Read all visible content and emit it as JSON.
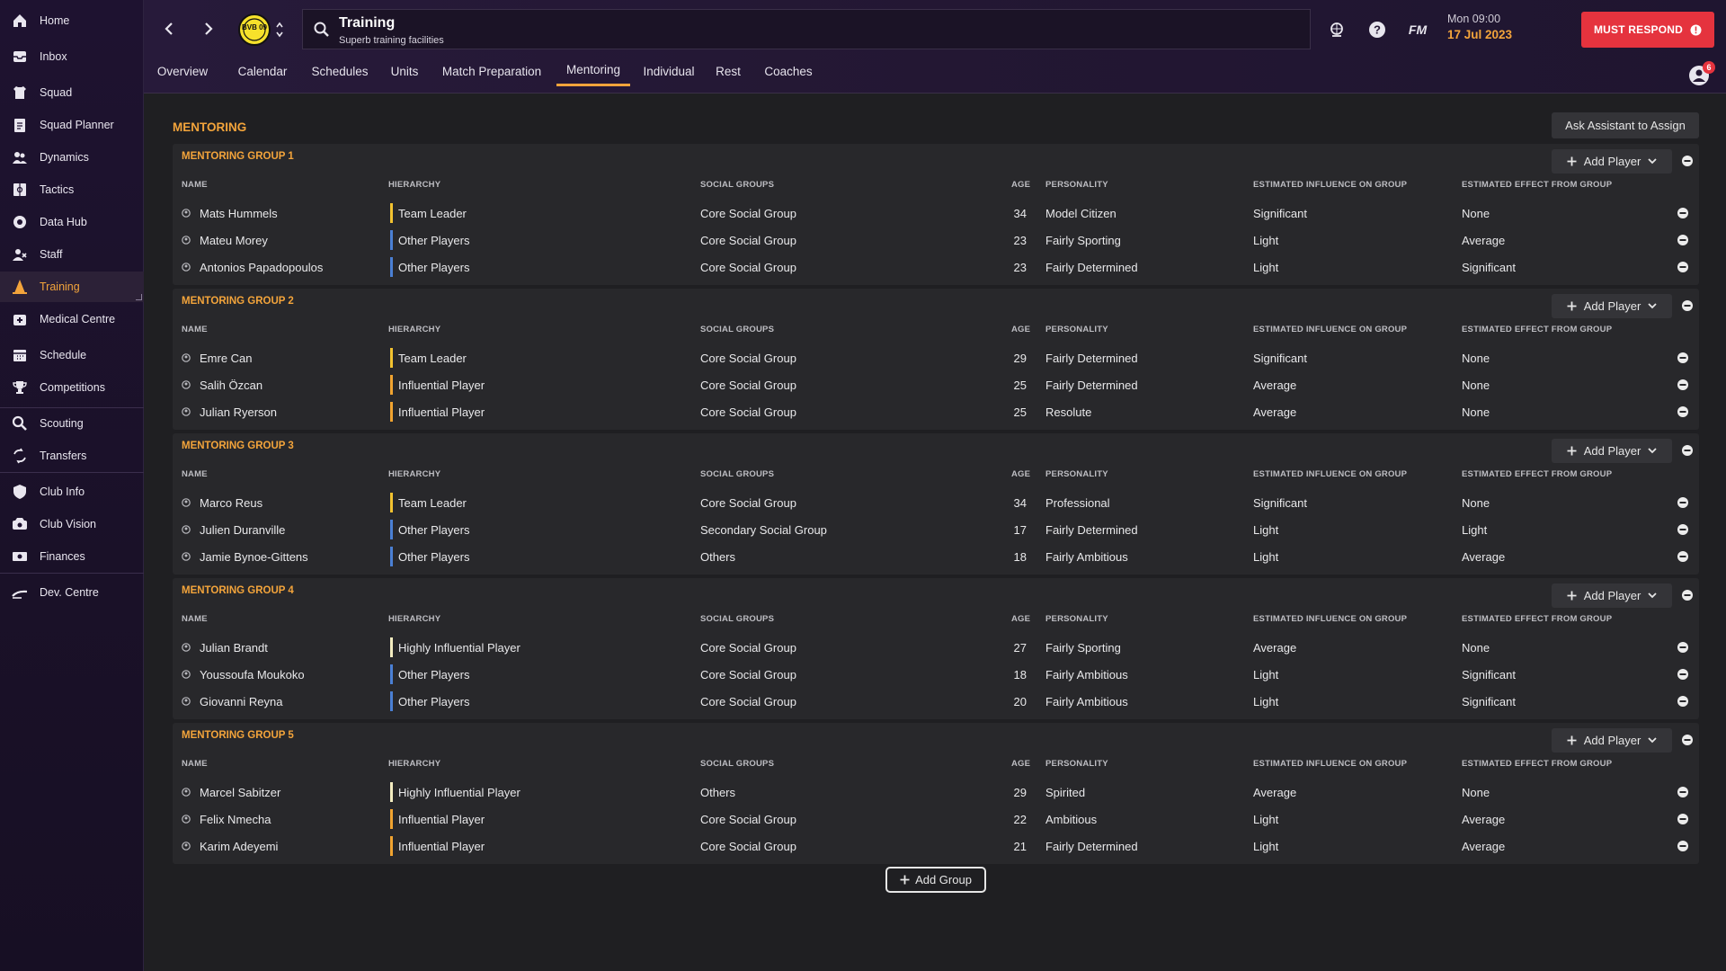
{
  "sidebar": {
    "items": [
      {
        "label": "Home",
        "icon": "home-icon"
      },
      {
        "label": "Inbox",
        "icon": "inbox-icon"
      },
      {
        "label": "Squad",
        "icon": "shirt-icon"
      },
      {
        "label": "Squad Planner",
        "icon": "clipboard-icon"
      },
      {
        "label": "Dynamics",
        "icon": "people-icon"
      },
      {
        "label": "Tactics",
        "icon": "tactics-board-icon"
      },
      {
        "label": "Data Hub",
        "icon": "data-hub-icon"
      },
      {
        "label": "Staff",
        "icon": "staff-icon"
      },
      {
        "label": "Training",
        "icon": "training-cone-icon"
      },
      {
        "label": "Medical Centre",
        "icon": "medical-kit-icon"
      },
      {
        "label": "Schedule",
        "icon": "calendar-icon"
      },
      {
        "label": "Competitions",
        "icon": "trophy-icon"
      },
      {
        "label": "Scouting",
        "icon": "magnifier-icon"
      },
      {
        "label": "Transfers",
        "icon": "transfer-arrows-icon"
      },
      {
        "label": "Club Info",
        "icon": "shield-icon"
      },
      {
        "label": "Club Vision",
        "icon": "vision-icon"
      },
      {
        "label": "Finances",
        "icon": "money-icon"
      },
      {
        "label": "Dev. Centre",
        "icon": "dev-centre-icon"
      }
    ]
  },
  "header": {
    "title": "Training",
    "subtitle": "Superb training facilities",
    "club_badge": "BVB 09",
    "fm_label": "FM",
    "day_time": "Mon 09:00",
    "date": "17 Jul 2023",
    "must_respond": "MUST RESPOND",
    "notification_count": "6",
    "tabs": [
      "Overview",
      "Calendar",
      "Schedules",
      "Units",
      "Match Preparation",
      "Mentoring",
      "Individual",
      "Rest",
      "Coaches"
    ],
    "active_tab": "Mentoring"
  },
  "main": {
    "title": "MENTORING",
    "ask_assistant": "Ask Assistant to Assign",
    "add_player": "Add Player",
    "add_group": "Add Group",
    "columns": [
      "NAME",
      "HIERARCHY",
      "SOCIAL GROUPS",
      "AGE",
      "PERSONALITY",
      "ESTIMATED INFLUENCE ON GROUP",
      "ESTIMATED EFFECT FROM GROUP"
    ],
    "hierarchy_colors": {
      "Team Leader": "#f2c230",
      "Highly Influential Player": "#f3ecc0",
      "Influential Player": "#f0a330",
      "Other Players": "#4a7fd4"
    },
    "groups": [
      {
        "title": "MENTORING GROUP 1",
        "players": [
          {
            "name": "Mats Hummels",
            "hierarchy": "Team Leader",
            "social": "Core Social Group",
            "age": "34",
            "personality": "Model Citizen",
            "influence": "Significant",
            "effect": "None"
          },
          {
            "name": "Mateu Morey",
            "hierarchy": "Other Players",
            "social": "Core Social Group",
            "age": "23",
            "personality": "Fairly Sporting",
            "influence": "Light",
            "effect": "Average"
          },
          {
            "name": "Antonios Papadopoulos",
            "hierarchy": "Other Players",
            "social": "Core Social Group",
            "age": "23",
            "personality": "Fairly Determined",
            "influence": "Light",
            "effect": "Significant"
          }
        ]
      },
      {
        "title": "MENTORING GROUP 2",
        "players": [
          {
            "name": "Emre Can",
            "hierarchy": "Team Leader",
            "social": "Core Social Group",
            "age": "29",
            "personality": "Fairly Determined",
            "influence": "Significant",
            "effect": "None"
          },
          {
            "name": "Salih Özcan",
            "hierarchy": "Influential Player",
            "social": "Core Social Group",
            "age": "25",
            "personality": "Fairly Determined",
            "influence": "Average",
            "effect": "None"
          },
          {
            "name": "Julian Ryerson",
            "hierarchy": "Influential Player",
            "social": "Core Social Group",
            "age": "25",
            "personality": "Resolute",
            "influence": "Average",
            "effect": "None"
          }
        ]
      },
      {
        "title": "MENTORING GROUP 3",
        "players": [
          {
            "name": "Marco Reus",
            "hierarchy": "Team Leader",
            "social": "Core Social Group",
            "age": "34",
            "personality": "Professional",
            "influence": "Significant",
            "effect": "None"
          },
          {
            "name": "Julien Duranville",
            "hierarchy": "Other Players",
            "social": "Secondary Social Group",
            "age": "17",
            "personality": "Fairly Determined",
            "influence": "Light",
            "effect": "Light"
          },
          {
            "name": "Jamie Bynoe-Gittens",
            "hierarchy": "Other Players",
            "social": "Others",
            "age": "18",
            "personality": "Fairly Ambitious",
            "influence": "Light",
            "effect": "Average"
          }
        ]
      },
      {
        "title": "MENTORING GROUP 4",
        "players": [
          {
            "name": "Julian Brandt",
            "hierarchy": "Highly Influential Player",
            "social": "Core Social Group",
            "age": "27",
            "personality": "Fairly Sporting",
            "influence": "Average",
            "effect": "None"
          },
          {
            "name": "Youssoufa Moukoko",
            "hierarchy": "Other Players",
            "social": "Core Social Group",
            "age": "18",
            "personality": "Fairly Ambitious",
            "influence": "Light",
            "effect": "Significant"
          },
          {
            "name": "Giovanni Reyna",
            "hierarchy": "Other Players",
            "social": "Core Social Group",
            "age": "20",
            "personality": "Fairly Ambitious",
            "influence": "Light",
            "effect": "Significant"
          }
        ]
      },
      {
        "title": "MENTORING GROUP 5",
        "players": [
          {
            "name": "Marcel Sabitzer",
            "hierarchy": "Highly Influential Player",
            "social": "Others",
            "age": "29",
            "personality": "Spirited",
            "influence": "Average",
            "effect": "None"
          },
          {
            "name": "Felix Nmecha",
            "hierarchy": "Influential Player",
            "social": "Core Social Group",
            "age": "22",
            "personality": "Ambitious",
            "influence": "Light",
            "effect": "Average"
          },
          {
            "name": "Karim Adeyemi",
            "hierarchy": "Influential Player",
            "social": "Core Social Group",
            "age": "21",
            "personality": "Fairly Determined",
            "influence": "Light",
            "effect": "Average"
          }
        ]
      }
    ]
  }
}
